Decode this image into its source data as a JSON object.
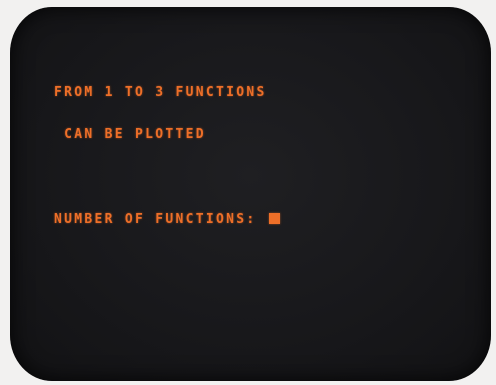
{
  "screen": {
    "lines": [
      "FROM 1 TO 3 FUNCTIONS",
      " CAN BE PLOTTED"
    ],
    "prompt": "NUMBER OF FUNCTIONS: ",
    "colors": {
      "text": "#ee6f28",
      "screen": "#18181b",
      "bezel": "#f2f1f0"
    }
  }
}
